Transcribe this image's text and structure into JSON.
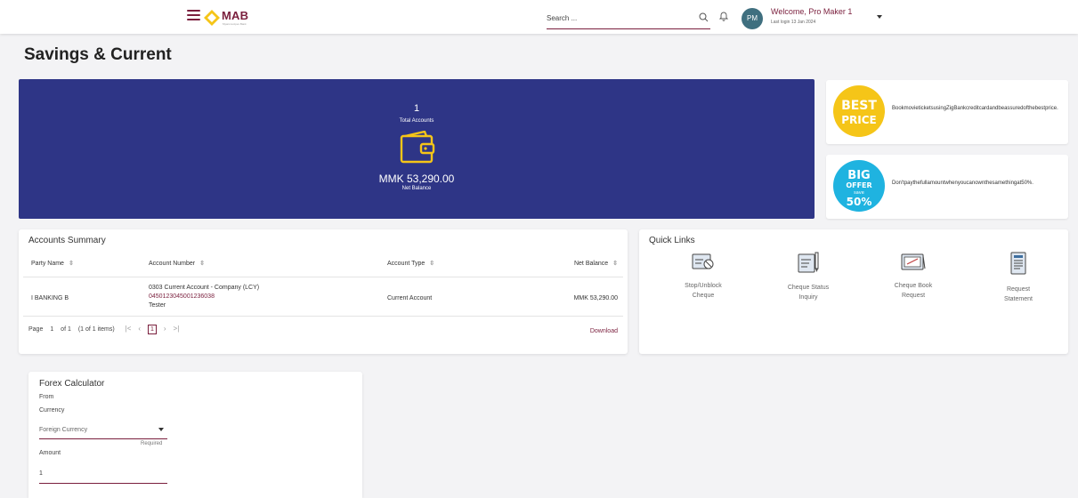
{
  "header": {
    "logo_text": "MAB",
    "logo_tagline": "Myanma Apex Bank",
    "search_placeholder": "Search ...",
    "avatar_initials": "PM",
    "welcome": "Welcome, Pro Maker 1",
    "last_login": "Last login 13 Jan 2024"
  },
  "page_title": "Savings & Current",
  "summary": {
    "count": "1",
    "count_label": "Total Accounts",
    "balance": "MMK 53,290.00",
    "balance_label": "Net Balance"
  },
  "promos": [
    {
      "badge_top": "BEST",
      "badge_bottom": "PRICE",
      "text": "BookmovieticketsusingZigBankcreditcardandbeassuredofthebestprice."
    },
    {
      "badge_top": "BIG",
      "badge_mid": "OFFER",
      "badge_save": "save",
      "badge_pct": "50%",
      "text": "Don'tpaythefullamountwhenyoucanownthesamethingat50%."
    }
  ],
  "accounts": {
    "title": "Accounts Summary",
    "columns": [
      "Party Name",
      "Account Number",
      "Account Type",
      "Net Balance"
    ],
    "sort_glyph": "⇳",
    "rows": [
      {
        "party": "I BANKING B",
        "acc_desc": "0303 Current Account - Company (LCY)",
        "acc_number": "0450123045001236038",
        "acc_nick": "Tester",
        "type": "Current Account",
        "balance": "MMK 53,290.00"
      }
    ],
    "pager": {
      "page_label": "Page",
      "page_num": "1",
      "of_label": "of 1",
      "items": "(1 of 1 items)",
      "first": "|<",
      "prev": "‹",
      "current": "1",
      "next": "›",
      "last": ">|"
    },
    "download": "Download"
  },
  "quick_links": {
    "title": "Quick Links",
    "items": [
      {
        "line1": "Stop/Unblock",
        "line2": "Cheque"
      },
      {
        "line1": "Cheque Status",
        "line2": "Inquiry"
      },
      {
        "line1": "Cheque Book",
        "line2": "Request"
      },
      {
        "line1": "Request",
        "line2": "Statement"
      }
    ]
  },
  "forex": {
    "title": "Forex Calculator",
    "from_label": "From",
    "currency_label": "Currency",
    "currency_value": "Foreign Currency",
    "required": "Required",
    "amount_label": "Amount",
    "amount_value": "1"
  },
  "colors": {
    "brand": "#7a1f3d",
    "hero": "#2e3586",
    "accent_gold": "#f5c518",
    "accent_cyan": "#1fb3e0"
  }
}
